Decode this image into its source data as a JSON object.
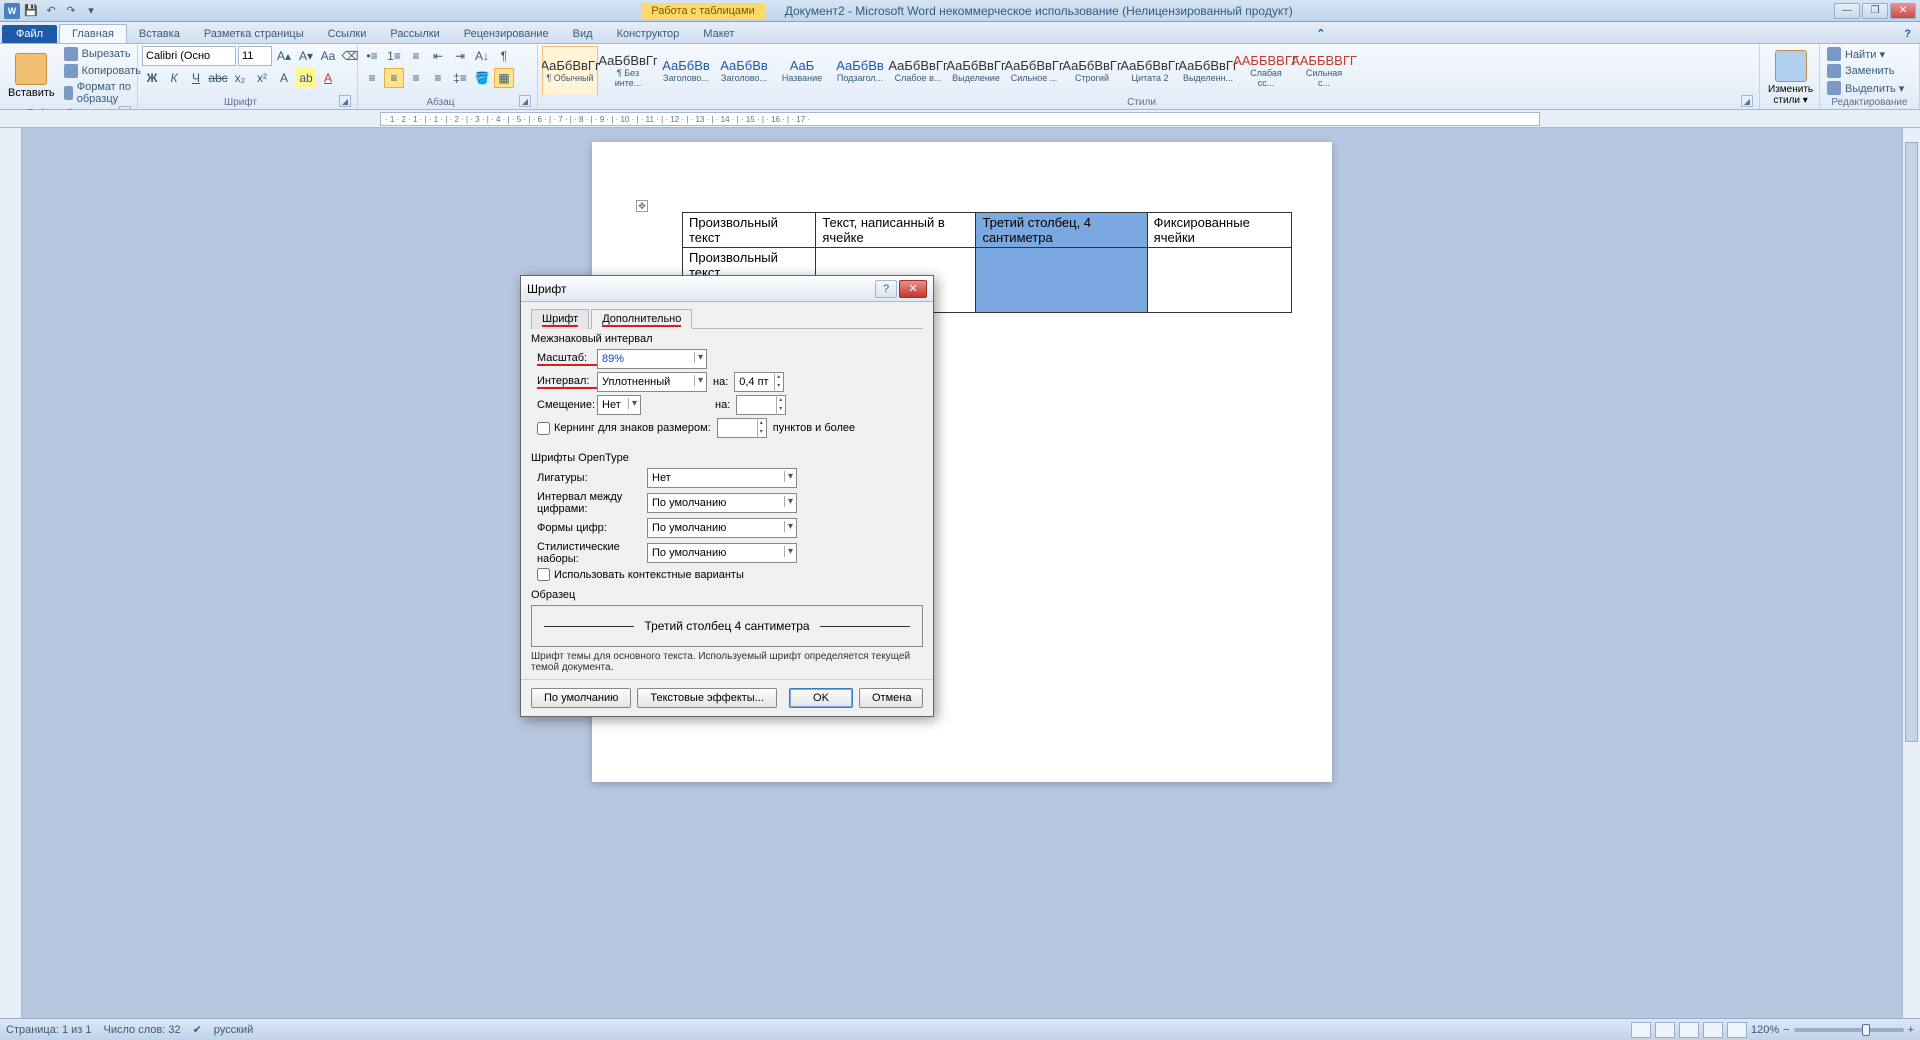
{
  "titlebar": {
    "contextual_label": "Работа с таблицами",
    "doc_title": "Документ2 - Microsoft Word некоммерческое использование (Нелицензированный продукт)"
  },
  "tabs": {
    "file": "Файл",
    "home": "Главная",
    "insert": "Вставка",
    "layout": "Разметка страницы",
    "references": "Ссылки",
    "mailings": "Рассылки",
    "review": "Рецензирование",
    "view": "Вид",
    "design": "Конструктор",
    "table_layout": "Макет"
  },
  "ribbon": {
    "clipboard": {
      "paste": "Вставить",
      "cut": "Вырезать",
      "copy": "Копировать",
      "format_painter": "Формат по образцу",
      "label": "Буфер обмена"
    },
    "font": {
      "name": "Calibri (Осно",
      "size": "11",
      "label": "Шрифт"
    },
    "paragraph": {
      "label": "Абзац"
    },
    "styles": {
      "label": "Стили",
      "items": [
        {
          "preview": "АаБбВвГг",
          "name": "¶ Обычный"
        },
        {
          "preview": "АаБбВвГг",
          "name": "¶ Без инте..."
        },
        {
          "preview": "АаБбВв",
          "name": "Заголово..."
        },
        {
          "preview": "АаБбВв",
          "name": "Заголово..."
        },
        {
          "preview": "АаБ",
          "name": "Название"
        },
        {
          "preview": "АаБбВв",
          "name": "Подзагол..."
        },
        {
          "preview": "АаБбВвГг",
          "name": "Слабое в..."
        },
        {
          "preview": "АаБбВвГг",
          "name": "Выделение"
        },
        {
          "preview": "АаБбВвГг",
          "name": "Сильное ..."
        },
        {
          "preview": "АаБбВвГг",
          "name": "Строгий"
        },
        {
          "preview": "АаБбВвГг",
          "name": "Цитата 2"
        },
        {
          "preview": "АаБбВвГг",
          "name": "Выделенн..."
        },
        {
          "preview": "ААББВВГГ",
          "name": "Слабая сс..."
        },
        {
          "preview": "ААББВВГГ",
          "name": "Сильная с..."
        }
      ],
      "change": "Изменить стили ▾"
    },
    "editing": {
      "find": "Найти ▾",
      "replace": "Заменить",
      "select": "Выделить ▾",
      "label": "Редактирование"
    }
  },
  "table": {
    "r1": [
      "Произвольный текст",
      "Текст, написанный в ячейке",
      "Третий столбец, 4 сантиметра",
      "Фиксированные ячейки"
    ],
    "r2": [
      "Произвольный текст. Фиксированные ячейки",
      "",
      "",
      ""
    ]
  },
  "dialog": {
    "title": "Шрифт",
    "tab_font": "Шрифт",
    "tab_advanced": "Дополнительно",
    "section_charspacing": "Межзнаковый интервал",
    "scale_label": "Масштаб:",
    "scale_value": "89%",
    "spacing_label": "Интервал:",
    "spacing_value": "Уплотненный",
    "by_label": "на:",
    "by_value": "0,4 пт",
    "position_label": "Смещение:",
    "position_value": "Нет",
    "by2_label": "на:",
    "by2_value": "",
    "kerning_label": "Кернинг для знаков размером:",
    "kerning_suffix": "пунктов и более",
    "section_opentype": "Шрифты OpenType",
    "ligatures_label": "Лигатуры:",
    "ligatures_value": "Нет",
    "numspacing_label": "Интервал между цифрами:",
    "numspacing_value": "По умолчанию",
    "numforms_label": "Формы цифр:",
    "numforms_value": "По умолчанию",
    "stylesets_label": "Стилистические наборы:",
    "stylesets_value": "По умолчанию",
    "contextual_label": "Использовать контекстные варианты",
    "sample_label": "Образец",
    "sample_text": "Третий столбец 4 сантиметра",
    "sample_desc": "Шрифт темы для основного текста. Используемый шрифт определяется текущей темой документа.",
    "btn_default": "По умолчанию",
    "btn_effects": "Текстовые эффекты...",
    "btn_ok": "OK",
    "btn_cancel": "Отмена"
  },
  "statusbar": {
    "page": "Страница: 1 из 1",
    "words": "Число слов: 32",
    "lang": "русский",
    "zoom": "120%"
  }
}
